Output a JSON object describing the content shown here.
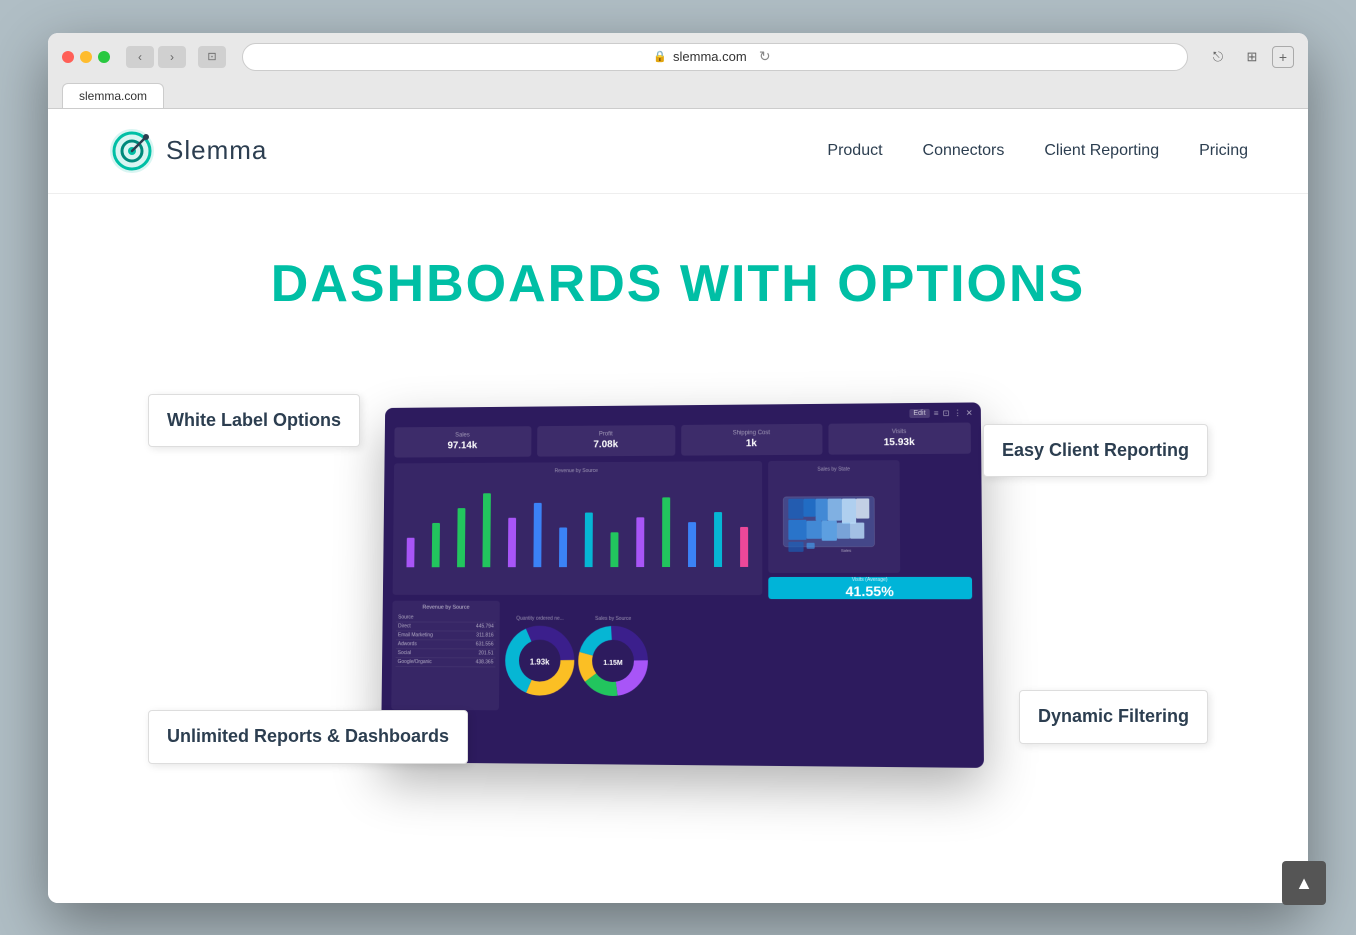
{
  "browser": {
    "url": "slemma.com",
    "tab_label": "slemma.com"
  },
  "logo": {
    "text": "Slemma"
  },
  "nav": {
    "items": [
      {
        "label": "Product",
        "id": "product"
      },
      {
        "label": "Connectors",
        "id": "connectors"
      },
      {
        "label": "Client Reporting",
        "id": "client-reporting"
      },
      {
        "label": "Pricing",
        "id": "pricing"
      }
    ]
  },
  "hero": {
    "title": "DASHBOARDS WITH OPTIONS"
  },
  "callouts": {
    "white_label": "White Label Options",
    "unlimited_reports": "Unlimited Reports & Dashboards",
    "easy_client": "Easy Client Reporting",
    "dynamic_filtering": "Dynamic Filtering"
  },
  "dashboard": {
    "stats": [
      {
        "label": "Sales",
        "value": "97.14k"
      },
      {
        "label": "Profit",
        "value": "7.08k"
      },
      {
        "label": "Shipping Cost",
        "value": "1k"
      },
      {
        "label": "Visits",
        "value": "15.93k"
      }
    ],
    "bar_chart_label": "Revenue by Source",
    "bar_chart_label2": "Revenue by Source",
    "map_label": "Sales by State",
    "big_number": "41.55%",
    "big_number_sublabel": "Visits (Average)",
    "donut1_label": "Quantity ordered ne...",
    "donut1_value": "1.93k",
    "donut2_label": "Sales by Source",
    "donut2_value": "1.15M",
    "table_headers": [
      "Source",
      ""
    ],
    "table_rows": [
      [
        "Direct",
        "445.794k"
      ],
      [
        "Email Marketing",
        "311.816k"
      ],
      [
        "Adwords",
        "631.556k"
      ],
      [
        "Social",
        "201.51k"
      ],
      [
        "Google/Organic",
        "438.365k"
      ]
    ]
  },
  "scroll_top": "▲"
}
